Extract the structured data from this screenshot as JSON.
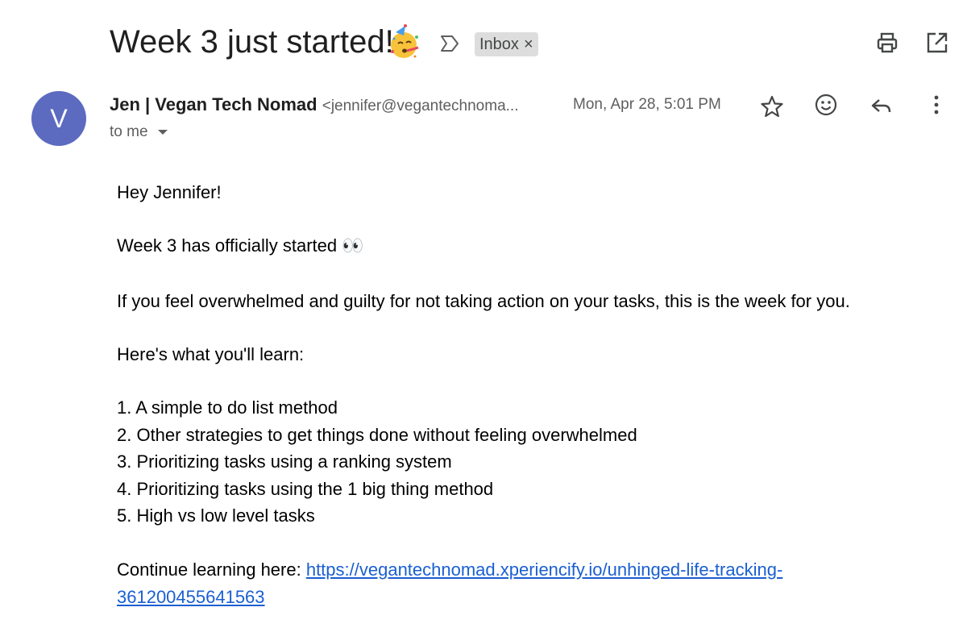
{
  "header": {
    "subject": "Week 3 just started!",
    "subject_emoji_icon": "partying-face-icon",
    "label_chip": "Inbox",
    "label_remove": "×"
  },
  "message": {
    "avatar_letter": "V",
    "sender_name": "Jen | Vegan Tech Nomad",
    "sender_email": "<jennifer@vegantechnoma...",
    "date": "Mon, Apr 28, 5:01 PM",
    "to_label": "to me"
  },
  "body": {
    "greeting": "Hey Jennifer!",
    "week_line": "Week 3 has officially started",
    "week_line_emoji": "👀",
    "intro": "If you feel overwhelmed and guilty for not taking action on your tasks, this is the week for you.",
    "learn_heading": "Here's what you'll learn:",
    "list": [
      "1. A simple to do list method",
      "2. Other strategies to get things done without feeling overwhelmed",
      "3. Prioritizing tasks using a ranking system",
      "4. Prioritizing tasks using the 1 big thing method",
      "5. High vs low level tasks"
    ],
    "continue_label": "Continue learning here: ",
    "link_line1": "https://vegantechnomad.xperiencify.io/unhinged-life-tracking-",
    "link_line2": "361200455641563"
  },
  "colors": {
    "avatar": "#5c6bc0",
    "link": "#1a5fd2",
    "chip_bg": "#dddddd"
  }
}
